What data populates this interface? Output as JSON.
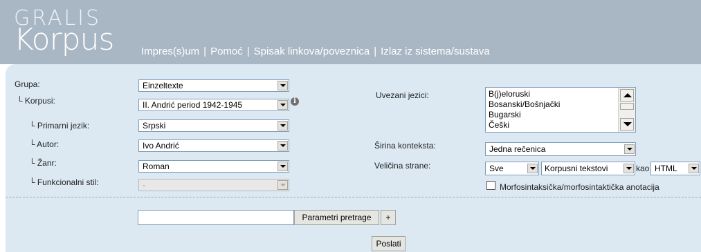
{
  "logo": {
    "line1": "GRALIS",
    "line2": "Korpus"
  },
  "nav": [
    {
      "label": "Impres(s)um"
    },
    {
      "label": "Pomoć"
    },
    {
      "label": "Spisak linkova/poveznica"
    },
    {
      "label": "Izlaz iz sistema/sustava"
    }
  ],
  "nav_separator": "|",
  "form": {
    "grupa": {
      "label": "Grupa:",
      "value": "Einzeltexte"
    },
    "korpusi": {
      "label": "└ Korpusi:",
      "value": "II. Andrić period 1942-1945",
      "info_icon": "i"
    },
    "primarni_jezik": {
      "label": "└ Primarni jezik:",
      "value": "Srpski"
    },
    "autor": {
      "label": "└ Autor:",
      "value": "Ivo Andrić"
    },
    "zanr": {
      "label": "└ Žanr:",
      "value": "Roman"
    },
    "funkcionalni_stil": {
      "label": "└ Funkcionalni stil:",
      "value": "-"
    },
    "uvezani_jezici": {
      "label": "Uvezani jezici:",
      "items": [
        "B(j)eloruski",
        "Bosanski/Bošnjački",
        "Bugarski",
        "Češki"
      ]
    },
    "sirina_konteksta": {
      "label": "Širina konteksta:",
      "value": "Jedna rečenica"
    },
    "velicina_strane": {
      "label": "Veličina strane:",
      "value": "Sve",
      "type_value": "Korpusni tekstovi",
      "kao_label": "kao",
      "format_value": "HTML"
    },
    "morfo": {
      "label": "Morfosintaksička/morfosintaktička anotacija",
      "checked": false
    }
  },
  "search": {
    "query": "",
    "params_button": "Parametri pretrage",
    "plus_button": "+",
    "submit_button": "Poslati"
  },
  "colors": {
    "header": "#a9b7c4",
    "panel": "#dce9f3"
  }
}
